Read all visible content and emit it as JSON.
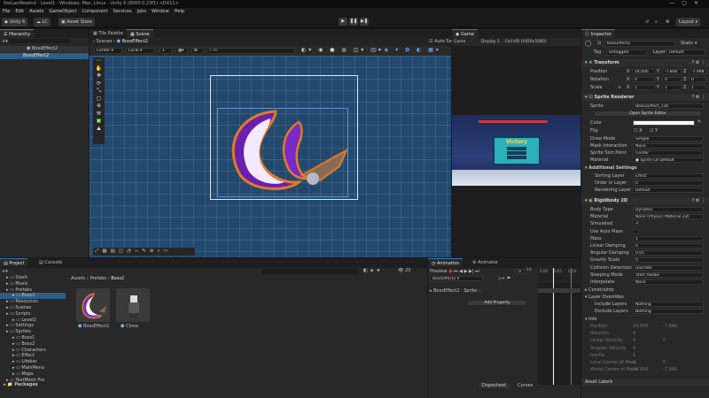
{
  "titlebar": {
    "text": "theLastRewind - Level1 - Windows, Mac, Linux - Unity 6 (6000.0.23f1) <DX11>"
  },
  "menu": [
    "File",
    "Edit",
    "Assets",
    "GameObject",
    "Component",
    "Services",
    "Jobs",
    "Window",
    "Help"
  ],
  "toolbar": {
    "unity_label": "Unity 6",
    "lc_label": "LC",
    "asset_store": "Asset Store",
    "layout": "Layout"
  },
  "hierarchy": {
    "tab": "Hierarchy",
    "items": [
      "BossEffect2",
      "BossEffect2"
    ]
  },
  "tile_palette": {
    "tab": "Tile Palette"
  },
  "scene": {
    "tab": "Scene",
    "breadcrumb_root": "Scenes",
    "breadcrumb_current": "BossEffect2",
    "pivot": "Center",
    "space": "Local",
    "snap": "1",
    "search": "All",
    "auto_save": "Auto Save"
  },
  "game": {
    "tab": "Game",
    "mode": "Game",
    "display": "Display 1",
    "resolution": "Full HD (1920x1080)",
    "victory_text": "Victory"
  },
  "inspector": {
    "tab": "Inspector",
    "object_name": "BossEffect2",
    "static": "Static",
    "tag_label": "Tag",
    "tag": "Untagged",
    "layer_label": "Layer",
    "layer": "Default",
    "transform": {
      "title": "Transform",
      "position": {
        "label": "Position",
        "x": "24.006",
        "y": "-7.846",
        "z": "-7.998"
      },
      "rotation": {
        "label": "Rotation",
        "x": "0",
        "y": "0",
        "z": "0"
      },
      "scale": {
        "label": "Scale",
        "x": "1",
        "y": "1",
        "z": "1"
      }
    },
    "sprite_renderer": {
      "title": "Sprite Renderer",
      "sprite_label": "Sprite",
      "sprite": "Boss2Effect_126",
      "open_editor": "Open Sprite Editor",
      "color_label": "Color",
      "flip_label": "Flip",
      "flip_x": "X",
      "flip_y": "Y",
      "draw_mode_label": "Draw Mode",
      "draw_mode": "Simple",
      "mask_label": "Mask Interaction",
      "mask": "None",
      "sort_point_label": "Sprite Sort Point",
      "sort_point": "Center",
      "material_label": "Material",
      "material": "Sprite-Lit-Default"
    },
    "additional": {
      "title": "Additional Settings",
      "sorting_layer_label": "Sorting Layer",
      "sorting_layer": "Effect",
      "order_label": "Order in Layer",
      "order": "0",
      "rlm_label": "Rendering Layer M",
      "rlm": "Default"
    },
    "rigidbody": {
      "title": "Rigidbody 2D",
      "rows": [
        {
          "label": "Body Type",
          "value": "Dynamic"
        },
        {
          "label": "Material",
          "value": "None (Physics Material 2D)"
        },
        {
          "label": "Simulated",
          "value": "✔"
        },
        {
          "label": "Use Auto Mass",
          "value": ""
        },
        {
          "label": "Mass",
          "value": "1"
        },
        {
          "label": "Linear Damping",
          "value": "0"
        },
        {
          "label": "Angular Damping",
          "value": "0.05"
        },
        {
          "label": "Gravity Scale",
          "value": "0"
        },
        {
          "label": "Collision Detection",
          "value": "Discrete"
        },
        {
          "label": "Sleeping Mode",
          "value": "Start Awake"
        },
        {
          "label": "Interpolate",
          "value": "None"
        }
      ],
      "constraints": "Constraints",
      "layer_overrides": "Layer Overrides",
      "include_label": "Include Layers",
      "include": "Nothing",
      "exclude_label": "Exclude Layers",
      "exclude": "Nothing",
      "info": "Info",
      "info_rows": [
        {
          "label": "Position",
          "x": "24.006",
          "y": "-7.846"
        },
        {
          "label": "Rotation",
          "x": "0",
          "y": ""
        },
        {
          "label": "Linear Velocity",
          "x": "0",
          "y": "0"
        },
        {
          "label": "Angular Velocity",
          "x": "0",
          "y": ""
        },
        {
          "label": "Inertia",
          "x": "1",
          "y": ""
        },
        {
          "label": "Local Center of Mass",
          "x": "0",
          "y": "0"
        },
        {
          "label": "World Center of Mass",
          "x": "24.006",
          "y": "-7.846"
        }
      ]
    },
    "asset_labels": "Asset Labels"
  },
  "project": {
    "tab": "Project",
    "console_tab": "Console",
    "count": "23",
    "breadcrumb": [
      "Assets",
      "Prefabs",
      "Boss2"
    ],
    "tree": [
      "Slash",
      "Music",
      "Prefabs",
      "Boss2",
      "Resources",
      "Scenes",
      "Scripts",
      "Level2",
      "Settings",
      "Sprites",
      "Boss1",
      "Boss2",
      "Characters",
      "Effect",
      "Lifebar",
      "MainMenu",
      "Maps",
      "TextMesh Pro"
    ],
    "packages": "Packages",
    "assets": [
      "BossEffect2",
      "Clone"
    ]
  },
  "animation": {
    "tab": "Animation",
    "animator_tab": "Animator",
    "preview": "Preview",
    "frame": "0",
    "clip": "BossEffect2",
    "property": "BossEffect2 : Sprite",
    "add_property": "Add Property",
    "ruler": [
      "0:00",
      "0:05",
      "0:10"
    ],
    "dopesheet": "Dopesheet",
    "curves": "Curves",
    "samples": "10"
  },
  "colors": {
    "accent": "#3a79bb",
    "selection": "#2c5d87",
    "scene_bg": "#234a6e"
  }
}
